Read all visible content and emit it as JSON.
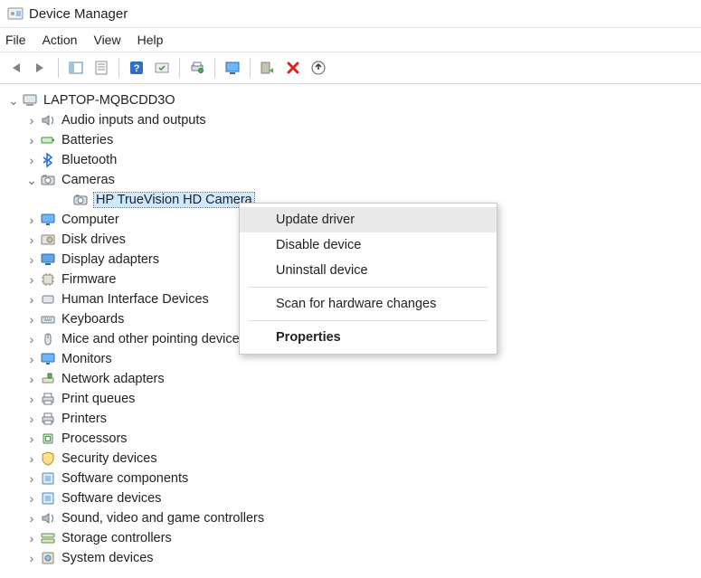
{
  "window": {
    "title": "Device Manager",
    "menus": [
      "File",
      "Action",
      "View",
      "Help"
    ]
  },
  "toolbar": {
    "hints": {
      "back": "Back",
      "forward": "Forward",
      "properties_pane": "Show/Hide Console Tree",
      "properties_sheet": "Properties",
      "help": "Help",
      "action": "Action",
      "print": "Print",
      "scan": "Scan for hardware changes",
      "update": "Update Driver Software",
      "uninstall": "Uninstall device",
      "eject": "Eject"
    }
  },
  "tree": {
    "root": {
      "label": "LAPTOP-MQBCDD3O",
      "expanded": true
    },
    "selected_path": "Cameras/HP TrueVision HD Camera",
    "nodes": [
      {
        "label": "Audio inputs and outputs",
        "icon": "speaker",
        "expanded": false
      },
      {
        "label": "Batteries",
        "icon": "battery",
        "expanded": false
      },
      {
        "label": "Bluetooth",
        "icon": "bluetooth",
        "expanded": false
      },
      {
        "label": "Cameras",
        "icon": "camera",
        "expanded": true,
        "children": [
          {
            "label": "HP TrueVision HD Camera",
            "icon": "camera",
            "selected": true
          }
        ]
      },
      {
        "label": "Computer",
        "icon": "monitor",
        "expanded": false
      },
      {
        "label": "Disk drives",
        "icon": "disk",
        "expanded": false
      },
      {
        "label": "Display adapters",
        "icon": "display",
        "expanded": false
      },
      {
        "label": "Firmware",
        "icon": "chip",
        "expanded": false
      },
      {
        "label": "Human Interface Devices",
        "icon": "hid",
        "expanded": false
      },
      {
        "label": "Keyboards",
        "icon": "keyboard",
        "expanded": false
      },
      {
        "label": "Mice and other pointing devices",
        "icon": "mouse",
        "expanded": false
      },
      {
        "label": "Monitors",
        "icon": "monitor",
        "expanded": false
      },
      {
        "label": "Network adapters",
        "icon": "network",
        "expanded": false
      },
      {
        "label": "Print queues",
        "icon": "printer",
        "expanded": false
      },
      {
        "label": "Printers",
        "icon": "printer",
        "expanded": false
      },
      {
        "label": "Processors",
        "icon": "cpu",
        "expanded": false
      },
      {
        "label": "Security devices",
        "icon": "security",
        "expanded": false
      },
      {
        "label": "Software components",
        "icon": "component",
        "expanded": false
      },
      {
        "label": "Software devices",
        "icon": "component",
        "expanded": false
      },
      {
        "label": "Sound, video and game controllers",
        "icon": "speaker",
        "expanded": false
      },
      {
        "label": "Storage controllers",
        "icon": "storage",
        "expanded": false
      },
      {
        "label": "System devices",
        "icon": "system",
        "expanded": false
      }
    ]
  },
  "contextMenu": {
    "items": [
      {
        "label": "Update driver",
        "hover": true
      },
      {
        "label": "Disable device"
      },
      {
        "label": "Uninstall device"
      },
      {
        "type": "sep"
      },
      {
        "label": "Scan for hardware changes"
      },
      {
        "type": "sep"
      },
      {
        "label": "Properties",
        "bold": true
      }
    ]
  }
}
